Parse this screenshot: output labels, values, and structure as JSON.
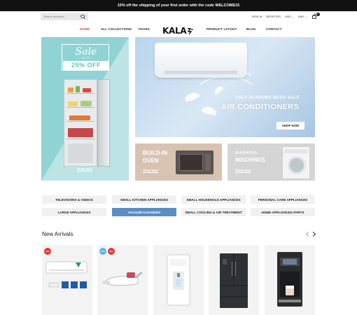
{
  "topbar": {
    "promo_text": "15% off the shipping of your first order with the code WELCOME15"
  },
  "search": {
    "placeholder": "Search products..."
  },
  "utils": {
    "signin": "SIGN IN",
    "register": "REGISTER",
    "currency": "USD ⌄",
    "language": "ENG ⌄",
    "cart_count": "0"
  },
  "nav": {
    "home": "HOME",
    "all_collections": "ALL COLLECTIONS",
    "pages": "PAGES",
    "product_layout": "PRODUCT LAYOUT",
    "blog": "BLOG",
    "contact": "CONTACT"
  },
  "logo": {
    "text": "KALA"
  },
  "banners": {
    "sale": {
      "script": "Sale",
      "upto": "UP TO",
      "discount": "25% OFF",
      "shop_now": "Shop Now"
    },
    "ac": {
      "subtitle": "ONLY 24 HOURS MEGA SALE",
      "title": "AIR CONDITIONERS",
      "shop_now": "SHOP NOW"
    },
    "oven": {
      "line1": "BUILD-IN",
      "line2": "OVEN",
      "shop_now": "Shop Now"
    },
    "wash": {
      "line1": "WASHING",
      "line2": "MACHINES",
      "shop_now": "Shop Now"
    }
  },
  "categories": [
    {
      "label": "TELEVISIONS & VIDEOS",
      "active": false
    },
    {
      "label": "SMALL KITCHEN APPLIANCES",
      "active": false
    },
    {
      "label": "SMALL HOUSEHOLD APPLIANCES",
      "active": false
    },
    {
      "label": "PERSONAL CARE APPLIANCES",
      "active": false
    },
    {
      "label": "LARGE APPLIANCES",
      "active": false
    },
    {
      "label": "VACUUM CLEANERS",
      "active": true
    },
    {
      "label": "SMALL COOLING & AIR TREATMENT",
      "active": false
    },
    {
      "label": "HOME APPLIANCES PARTS",
      "active": false
    }
  ],
  "new_arrivals": {
    "title": "New Arrivals",
    "products": [
      {
        "badges": [
          "Sale"
        ],
        "icon": "air-conditioner-icon"
      },
      {
        "badges": [
          "New",
          "Sale"
        ],
        "icon": "handheld-vacuum-icon"
      },
      {
        "badges": [],
        "icon": "water-dispenser-icon"
      },
      {
        "badges": [],
        "icon": "double-door-fridge-icon"
      },
      {
        "badges": [],
        "icon": "coffee-machine-icon"
      }
    ]
  },
  "colors": {
    "accent_red": "#e23a3a",
    "category_active": "#5b8cc4",
    "sale_teal": "#8fd3d5"
  }
}
